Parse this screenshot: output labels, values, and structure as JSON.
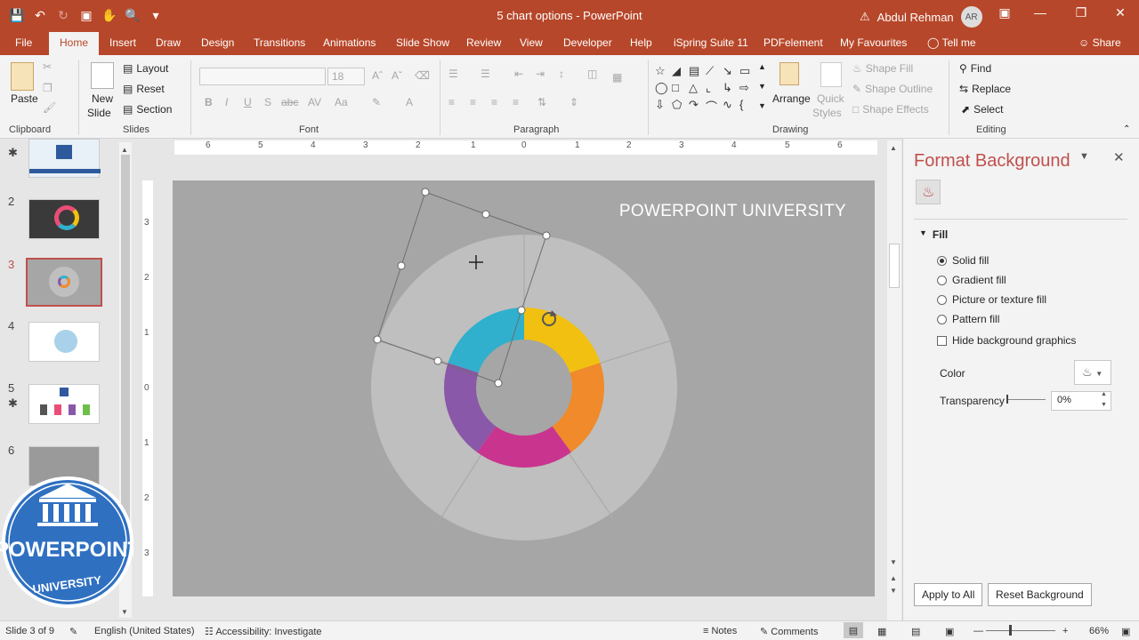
{
  "window": {
    "title": "5 chart options - PowerPoint",
    "user_name": "Abdul Rehman",
    "user_initials": "AR"
  },
  "tabs": [
    "File",
    "Home",
    "Insert",
    "Draw",
    "Design",
    "Transitions",
    "Animations",
    "Slide Show",
    "Review",
    "View",
    "Developer",
    "Help",
    "iSpring Suite 11",
    "PDFelement",
    "My Favourites"
  ],
  "tell_me": "Tell me",
  "share": "Share",
  "ribbon": {
    "clipboard": {
      "label": "Clipboard",
      "paste": "Paste"
    },
    "slides": {
      "label": "Slides",
      "new_slide_1": "New",
      "new_slide_2": "Slide",
      "layout": "Layout",
      "reset": "Reset",
      "section": "Section"
    },
    "font": {
      "label": "Font",
      "size": "18"
    },
    "paragraph": {
      "label": "Paragraph"
    },
    "drawing": {
      "label": "Drawing",
      "arrange": "Arrange",
      "quick_styles_1": "Quick",
      "quick_styles_2": "Styles",
      "shape_fill": "Shape Fill",
      "shape_outline": "Shape Outline",
      "shape_effects": "Shape Effects"
    },
    "editing": {
      "label": "Editing",
      "find": "Find",
      "replace": "Replace",
      "select": "Select"
    }
  },
  "thumbnails": [
    "2",
    "3",
    "4",
    "5",
    "6"
  ],
  "logo": {
    "line1": "POWERPOINT",
    "line2": "UNIVERSITY"
  },
  "ruler": {
    "h": [
      "6",
      "5",
      "4",
      "3",
      "2",
      "1",
      "0",
      "1",
      "2",
      "3",
      "4",
      "5",
      "6"
    ],
    "v": [
      "3",
      "2",
      "1",
      "0",
      "1",
      "2",
      "3"
    ]
  },
  "slide": {
    "title": "POWERPOINT UNIVERSITY",
    "colors": {
      "background": "#a6a6a6",
      "outer_ring": "#bfbfbf",
      "teal": "#31b0cd",
      "yellow": "#f2c010",
      "orange": "#f08a2a",
      "magenta": "#c9348f",
      "purple": "#8a58a8"
    }
  },
  "pane": {
    "title": "Format Background",
    "section": "Fill",
    "options": [
      "Solid fill",
      "Gradient fill",
      "Picture or texture fill",
      "Pattern fill"
    ],
    "selected": "Solid fill",
    "hide_bg": "Hide background graphics",
    "color_label": "Color",
    "transparency_label": "Transparency",
    "transparency_value": "0%",
    "apply_all": "Apply to All",
    "reset_bg": "Reset Background"
  },
  "status": {
    "slide_of": "Slide 3 of 9",
    "language": "English (United States)",
    "accessibility": "Accessibility: Investigate",
    "notes": "Notes",
    "comments": "Comments",
    "zoom": "66%"
  }
}
